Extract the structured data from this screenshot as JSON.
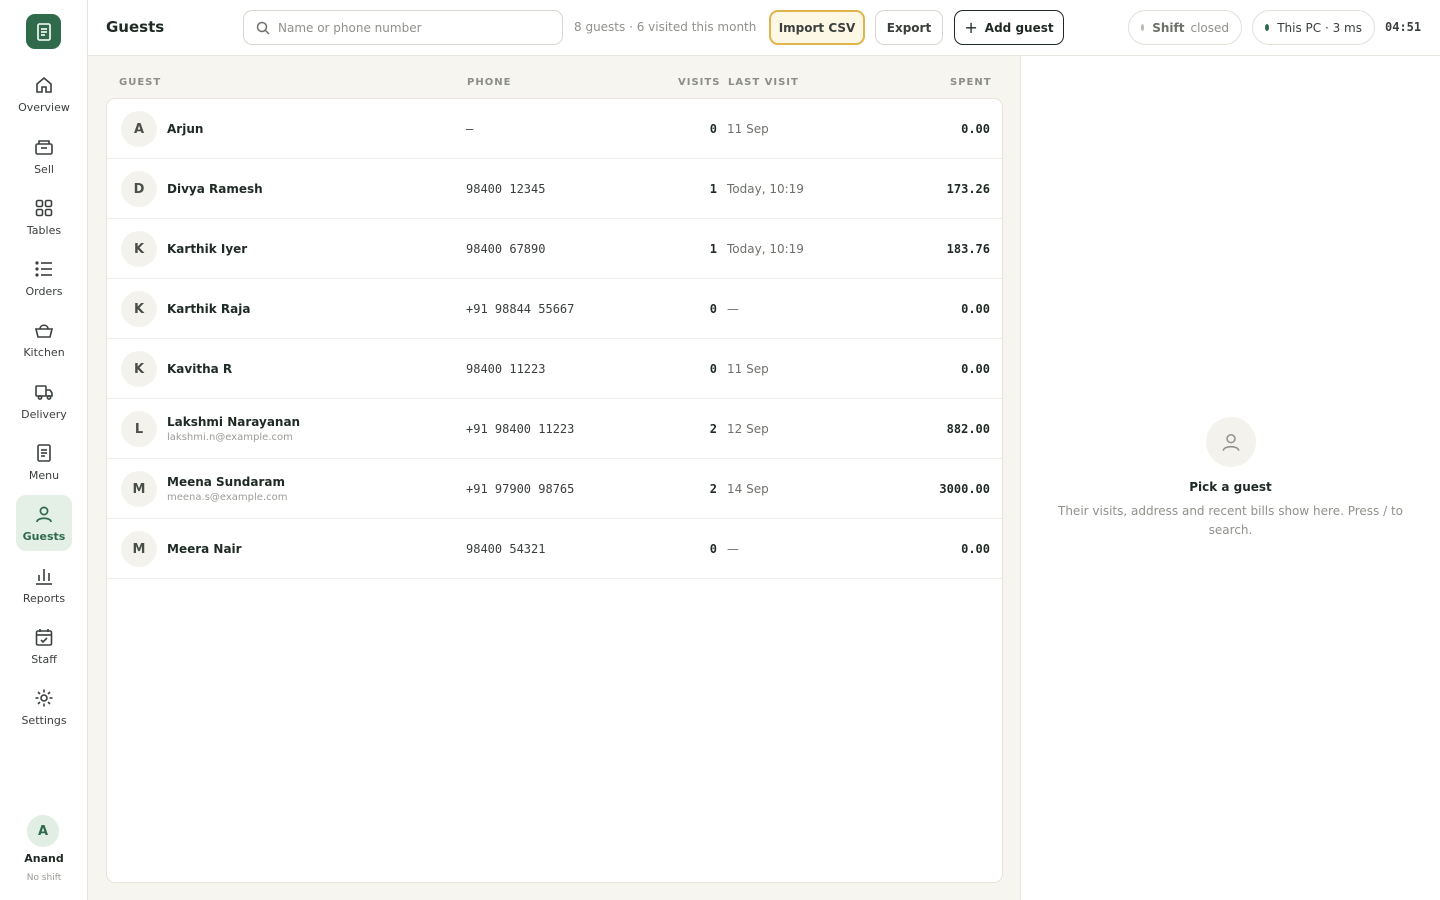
{
  "sidebar": {
    "items": [
      {
        "label": "Overview",
        "icon": "home-icon"
      },
      {
        "label": "Sell",
        "icon": "register-icon"
      },
      {
        "label": "Tables",
        "icon": "grid-icon"
      },
      {
        "label": "Orders",
        "icon": "list-icon"
      },
      {
        "label": "Kitchen",
        "icon": "basket-icon"
      },
      {
        "label": "Delivery",
        "icon": "delivery-truck-icon"
      },
      {
        "label": "Menu",
        "icon": "menu-document-icon"
      },
      {
        "label": "Guests",
        "icon": "user-icon",
        "active": true
      },
      {
        "label": "Reports",
        "icon": "bar-chart-icon"
      },
      {
        "label": "Staff",
        "icon": "calendar-check-icon"
      },
      {
        "label": "Settings",
        "icon": "gear-icon"
      }
    ],
    "user": {
      "initial": "A",
      "name": "Anand",
      "shift": "No shift"
    }
  },
  "header": {
    "title": "Guests",
    "search_placeholder": "Name or phone number",
    "summary": "8 guests · 6 visited this month",
    "import_label": "Import CSV",
    "export_label": "Export",
    "add_label": "Add guest",
    "shift_key": "Shift",
    "shift_value": "closed",
    "pc_status": "This PC · 3 ms",
    "clock": "04:51"
  },
  "table": {
    "columns": {
      "guest": "GUEST",
      "phone": "PHONE",
      "visits": "VISITS",
      "last_visit": "LAST VISIT",
      "spent": "SPENT"
    },
    "rows": [
      {
        "initial": "A",
        "name": "Arjun",
        "email": "",
        "phone": "–",
        "visits": "0",
        "last_visit": "11 Sep",
        "spent": "0.00"
      },
      {
        "initial": "D",
        "name": "Divya Ramesh",
        "email": "",
        "phone": "98400 12345",
        "visits": "1",
        "last_visit": "Today, 10:19",
        "spent": "173.26"
      },
      {
        "initial": "K",
        "name": "Karthik Iyer",
        "email": "",
        "phone": "98400 67890",
        "visits": "1",
        "last_visit": "Today, 10:19",
        "spent": "183.76"
      },
      {
        "initial": "K",
        "name": "Karthik Raja",
        "email": "",
        "phone": "+91 98844 55667",
        "visits": "0",
        "last_visit": "—",
        "spent": "0.00"
      },
      {
        "initial": "K",
        "name": "Kavitha R",
        "email": "",
        "phone": "98400 11223",
        "visits": "0",
        "last_visit": "11 Sep",
        "spent": "0.00"
      },
      {
        "initial": "L",
        "name": "Lakshmi Narayanan",
        "email": "lakshmi.n@example.com",
        "phone": "+91 98400 11223",
        "visits": "2",
        "last_visit": "12 Sep",
        "spent": "882.00"
      },
      {
        "initial": "M",
        "name": "Meena Sundaram",
        "email": "meena.s@example.com",
        "phone": "+91 97900 98765",
        "visits": "2",
        "last_visit": "14 Sep",
        "spent": "3000.00"
      },
      {
        "initial": "M",
        "name": "Meera Nair",
        "email": "",
        "phone": "98400 54321",
        "visits": "0",
        "last_visit": "—",
        "spent": "0.00"
      }
    ]
  },
  "detail": {
    "icon": "user-icon",
    "title": "Pick a guest",
    "text": "Their visits, address and recent bills show here. Press / to search."
  },
  "colors": {
    "brand": "#2f6a4a",
    "import_highlight": "#e0b44c",
    "list_background": "#f6f5ef",
    "shift_dot": "#b9bbb4",
    "pc_dot": "#2f6a4a"
  }
}
